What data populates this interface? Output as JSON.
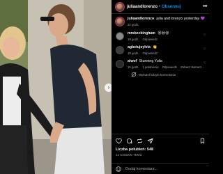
{
  "post": {
    "username": "juliaandlorenzo",
    "follow_label": "Obserwuj",
    "more_label": "•••"
  },
  "caption": {
    "username": "juliaandlorenzo",
    "text": "julia and lorenzo yesterday 💜",
    "time": "22 godz."
  },
  "comments": [
    {
      "username": "mrsbeckingham",
      "text": "😍😍😍",
      "time": "19 godz.",
      "reply_label": "Odpowiedz",
      "avatar_color": "#8a8a8a"
    },
    {
      "username": "agbetujsylvia",
      "text": "👏",
      "time": "18 godz.",
      "reply_label": "Odpowiedz",
      "avatar_color": "#3b3b3b"
    },
    {
      "username": "alwof",
      "text": "Stunning Yulia",
      "time": "15 godz.",
      "likes_label": "1 polubienie",
      "reply_label": "Odpowiedz",
      "translate_label": "Zobacz tłumacz...",
      "avatar_color": "#2a2a2a"
    }
  ],
  "view_replies_label": "Wyświetl ukryte komentarze",
  "likes_text": "Liczba polubień: 548",
  "date_text": "12 GODZIN TEMU",
  "add_comment_placeholder": "Dodaj komentarz...",
  "icons": {
    "like": "heart-icon",
    "comment": "comment-icon",
    "share": "repost-icon",
    "send": "send-icon",
    "save": "bookmark-icon",
    "emoji": "emoji-icon"
  },
  "colors": {
    "accent": "#0095f6",
    "background": "#000000",
    "muted": "#a8a8a8"
  }
}
